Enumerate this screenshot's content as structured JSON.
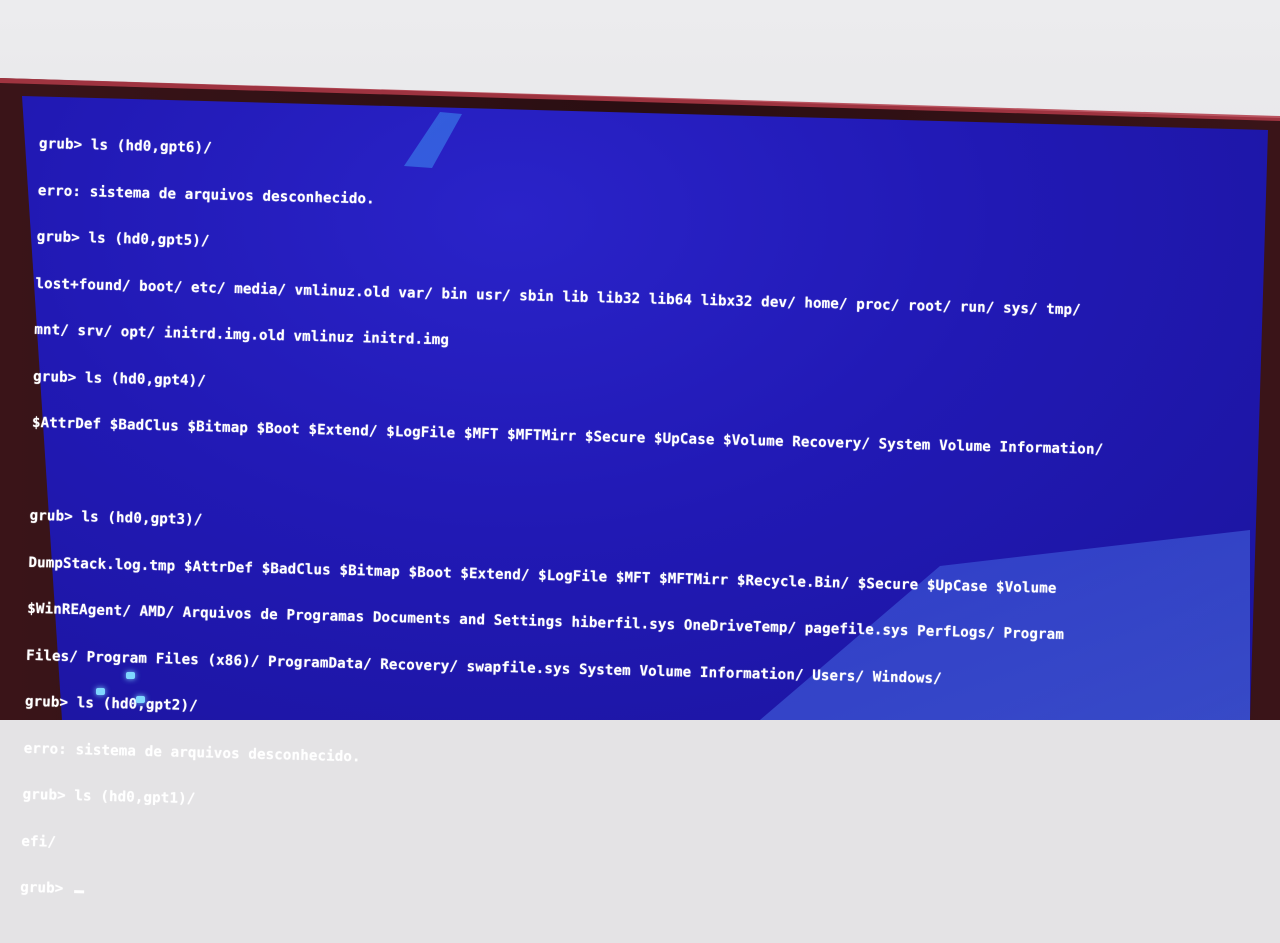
{
  "terminal": {
    "lines": [
      "grub> ls (hd0,gpt6)/",
      "erro: sistema de arquivos desconhecido.",
      "grub> ls (hd0,gpt5)/",
      "lost+found/ boot/ etc/ media/ vmlinuz.old var/ bin usr/ sbin lib lib32 lib64 libx32 dev/ home/ proc/ root/ run/ sys/ tmp/",
      "mnt/ srv/ opt/ initrd.img.old vmlinuz initrd.img",
      "grub> ls (hd0,gpt4)/",
      "$AttrDef $BadClus $Bitmap $Boot $Extend/ $LogFile $MFT $MFTMirr $Secure $UpCase $Volume Recovery/ System Volume Information/",
      "",
      "grub> ls (hd0,gpt3)/",
      "DumpStack.log.tmp $AttrDef $BadClus $Bitmap $Boot $Extend/ $LogFile $MFT $MFTMirr $Recycle.Bin/ $Secure $UpCase $Volume",
      "$WinREAgent/ AMD/ Arquivos de Programas Documents and Settings hiberfil.sys OneDriveTemp/ pagefile.sys PerfLogs/ Program",
      "Files/ Program Files (x86)/ ProgramData/ Recovery/ swapfile.sys System Volume Information/ Users/ Windows/",
      "grub> ls (hd0,gpt2)/",
      "erro: sistema de arquivos desconhecido.",
      "grub> ls (hd0,gpt1)/",
      "efi/",
      "grub> "
    ]
  },
  "colors": {
    "screen_background": "#2119b4",
    "terminal_text": "#ffffff",
    "bezel": "#b23a48"
  }
}
